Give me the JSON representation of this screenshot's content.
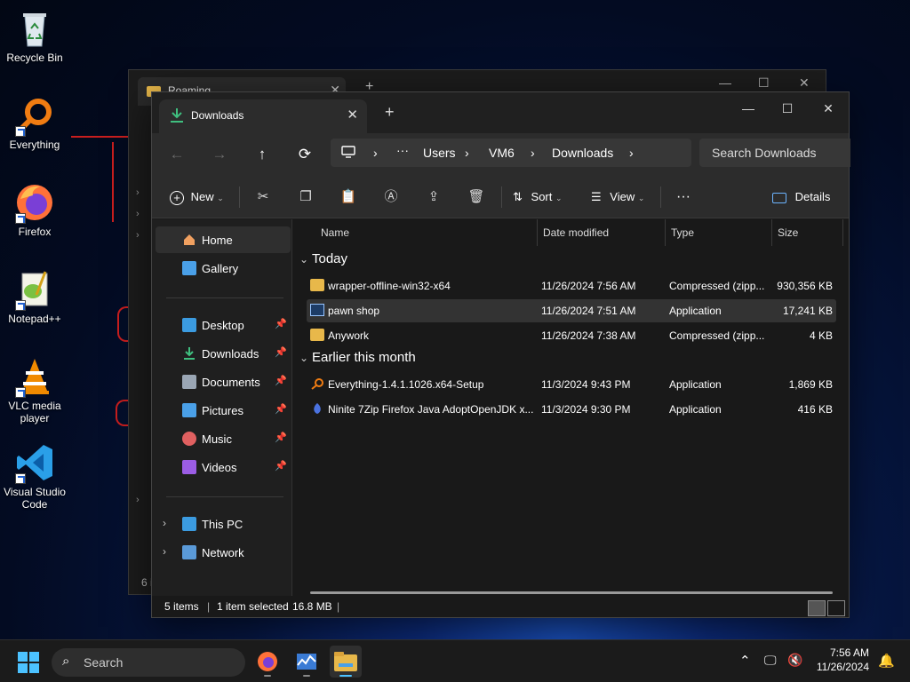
{
  "desktop": {
    "icons": [
      {
        "label": "Recycle Bin",
        "icon": "recycle-bin-icon"
      },
      {
        "label": "Everything",
        "icon": "everything-search-icon"
      },
      {
        "label": "Firefox",
        "icon": "firefox-icon"
      },
      {
        "label": "Notepad++",
        "icon": "notepad-plus-plus-icon"
      },
      {
        "label": "VLC media player",
        "icon": "vlc-icon"
      },
      {
        "label": "Visual Studio Code",
        "icon": "vscode-icon"
      }
    ]
  },
  "back_window": {
    "tab_title": "Roaming",
    "status": "6 i"
  },
  "window": {
    "tab_title": "Downloads",
    "breadcrumb": [
      "Users",
      "VM6",
      "Downloads"
    ],
    "ellipsis": "···",
    "search_placeholder": "Search Downloads",
    "toolbar": {
      "new_label": "New",
      "sort_label": "Sort",
      "view_label": "View",
      "more_label": "···",
      "details_label": "Details"
    },
    "sidebar": {
      "home": "Home",
      "gallery": "Gallery",
      "quick": [
        {
          "label": "Desktop",
          "icon": "desktop-icon",
          "color": "#3b9be0"
        },
        {
          "label": "Downloads",
          "icon": "downloads-icon",
          "color": "#3fbf7f"
        },
        {
          "label": "Documents",
          "icon": "documents-icon",
          "color": "#9aa6b4"
        },
        {
          "label": "Pictures",
          "icon": "pictures-icon",
          "color": "#4aa0e8"
        },
        {
          "label": "Music",
          "icon": "music-icon",
          "color": "#e06060"
        },
        {
          "label": "Videos",
          "icon": "videos-icon",
          "color": "#9b5de5"
        }
      ],
      "this_pc": "This PC",
      "network": "Network"
    },
    "columns": {
      "name": "Name",
      "date": "Date modified",
      "type": "Type",
      "size": "Size"
    },
    "groups": [
      {
        "label": "Today",
        "files": [
          {
            "name": "wrapper-offline-win32-x64",
            "date": "11/26/2024 7:56 AM",
            "type": "Compressed (zipp...",
            "size": "930,356 KB",
            "icon": "zip-folder-icon",
            "selected": false
          },
          {
            "name": "pawn shop",
            "date": "11/26/2024 7:51 AM",
            "type": "Application",
            "size": "17,241 KB",
            "icon": "application-icon",
            "selected": true
          },
          {
            "name": "Anywork",
            "date": "11/26/2024 7:38 AM",
            "type": "Compressed (zipp...",
            "size": "4 KB",
            "icon": "zip-folder-icon",
            "selected": false
          }
        ]
      },
      {
        "label": "Earlier this month",
        "files": [
          {
            "name": "Everything-1.4.1.1026.x64-Setup",
            "date": "11/3/2024 9:43 PM",
            "type": "Application",
            "size": "1,869 KB",
            "icon": "everything-search-icon",
            "selected": false
          },
          {
            "name": "Ninite 7Zip Firefox Java AdoptOpenJDK x...",
            "date": "11/3/2024 9:30 PM",
            "type": "Application",
            "size": "416 KB",
            "icon": "ninite-icon",
            "selected": false
          }
        ]
      }
    ],
    "status": {
      "items": "5 items",
      "selected": "1 item selected",
      "size": "16.8 MB"
    }
  },
  "taskbar": {
    "search_label": "Search",
    "time": "7:56 AM",
    "date": "11/26/2024"
  }
}
